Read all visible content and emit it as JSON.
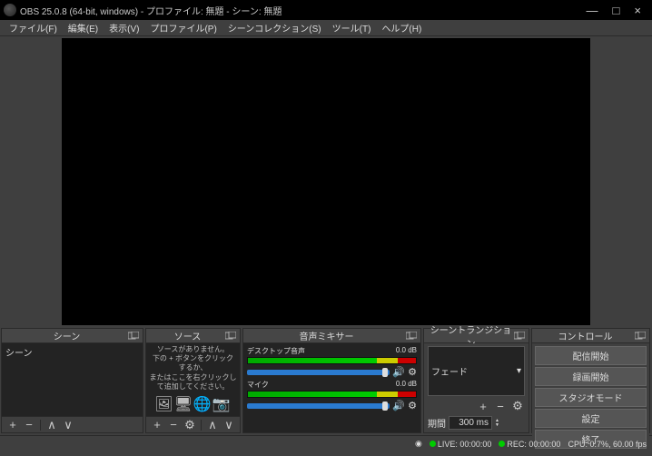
{
  "titlebar": {
    "title": "OBS 25.0.8 (64-bit, windows) - プロファイル: 無題 - シーン: 無題"
  },
  "menu": {
    "file": "ファイル(F)",
    "edit": "編集(E)",
    "view": "表示(V)",
    "profile": "プロファイル(P)",
    "scene_collection": "シーンコレクション(S)",
    "tools": "ツール(T)",
    "help": "ヘルプ(H)"
  },
  "scenes": {
    "title": "シーン",
    "items": [
      "シーン"
    ]
  },
  "sources": {
    "title": "ソース",
    "empty_line1": "ソースがありません。",
    "empty_line2": "下の + ボタンをクリックするか、",
    "empty_line3": "またはここを右クリックして追加してください。"
  },
  "mixer": {
    "title": "音声ミキサー",
    "tracks": [
      {
        "name": "デスクトップ音声",
        "db": "0.0 dB"
      },
      {
        "name": "マイク",
        "db": "0.0 dB"
      }
    ]
  },
  "transitions": {
    "title": "シーントランジション",
    "selected": "フェード",
    "duration_label": "期間",
    "duration_value": "300 ms"
  },
  "controls": {
    "title": "コントロール",
    "stream": "配信開始",
    "record": "録画開始",
    "studio": "スタジオモード",
    "settings": "設定",
    "exit": "終了"
  },
  "status": {
    "live": "LIVE: 00:00:00",
    "rec": "REC: 00:00:00",
    "cpu": "CPU: 0.7%, 60.00 fps"
  }
}
